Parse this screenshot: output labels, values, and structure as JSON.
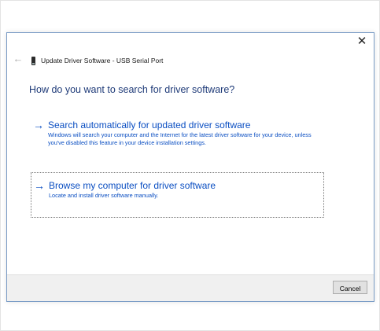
{
  "window": {
    "title": "Update Driver Software - USB Serial Port",
    "close_glyph": "✕",
    "back_glyph": "←"
  },
  "main": {
    "heading": "How do you want to search for driver software?",
    "options": [
      {
        "arrow": "→",
        "title": "Search automatically for updated driver software",
        "description": "Windows will search your computer and the Internet for the latest driver software for your device, unless you've disabled this feature in your device installation settings."
      },
      {
        "arrow": "→",
        "title": "Browse my computer for driver software",
        "description": "Locate and install driver software manually."
      }
    ]
  },
  "footer": {
    "cancel_label": "Cancel"
  },
  "icons": {
    "close": "close-icon",
    "back": "back-arrow-icon",
    "device": "usb-device-icon",
    "option_arrow": "right-arrow-icon"
  },
  "colors": {
    "link_blue": "#0a4ec2",
    "heading_blue": "#1e3a78",
    "footer_bg": "#f0f0f0"
  }
}
